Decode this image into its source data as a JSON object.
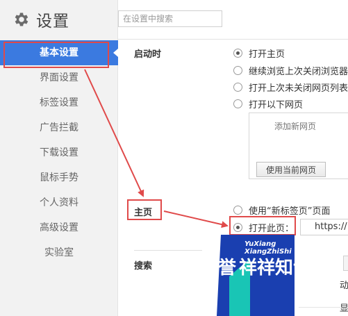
{
  "header": {
    "title": "设置",
    "search_placeholder": "在设置中搜索"
  },
  "sidebar": {
    "items": [
      {
        "label": "基本设置",
        "active": true
      },
      {
        "label": "界面设置"
      },
      {
        "label": "标签设置"
      },
      {
        "label": "广告拦截"
      },
      {
        "label": "下载设置"
      },
      {
        "label": "鼠标手势"
      },
      {
        "label": "个人资料"
      },
      {
        "label": "高级设置"
      },
      {
        "label": "实验室"
      }
    ]
  },
  "startup": {
    "label": "启动时",
    "options": [
      {
        "label": "打开主页",
        "checked": true
      },
      {
        "label": "继续浏览上次关闭浏览器",
        "checked": false
      },
      {
        "label": "打开上次未关闭网页列表",
        "checked": false
      },
      {
        "label": "打开以下网页",
        "checked": false
      }
    ],
    "add_new_page": "添加新网页",
    "use_current_button": "使用当前网页"
  },
  "homepage": {
    "label": "主页",
    "options": [
      {
        "label": "使用“新标签页”页面",
        "checked": false
      },
      {
        "label": "打开此页：",
        "checked": true
      }
    ],
    "url_value": "https://"
  },
  "search": {
    "label": "搜索",
    "fragment_1": "动",
    "fragment_2": "显"
  },
  "watermark": {
    "line1": "YuXiang",
    "line2": "XiangZhiShi",
    "glyph": "誉",
    "text": "祥祥知识"
  },
  "colors": {
    "accent": "#3b7ae0",
    "highlight": "#e04a4a",
    "watermark_blue": "#1a3fb0",
    "watermark_teal": "#19c5b5"
  }
}
